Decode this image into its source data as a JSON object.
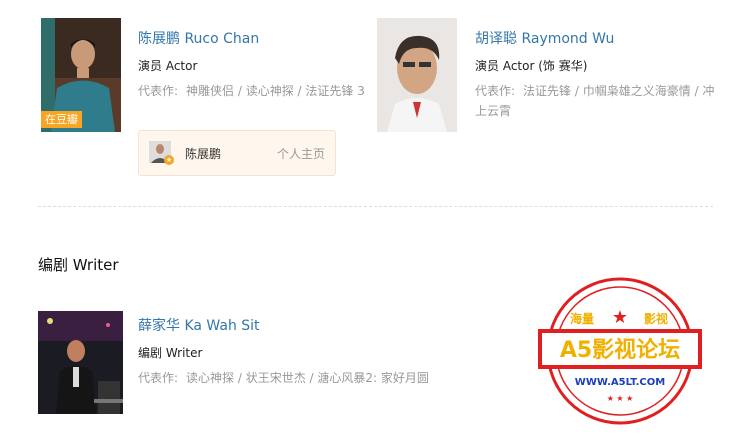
{
  "cast": [
    {
      "name": "陈展鹏 Ruco Chan",
      "role": "演员 Actor",
      "works_label": "代表作:",
      "works": "神雕侠侣 / 读心神探 / 法证先锋 3",
      "badge": "在豆瓣",
      "home": {
        "name": "陈展鹏",
        "link": "个人主页"
      }
    },
    {
      "name": "胡译聪 Raymond Wu",
      "role": "演员 Actor (饰 赛华)",
      "works_label": "代表作:",
      "works": "法证先锋 / 巾帼枭雄之义海豪情 / 冲上云霄"
    }
  ],
  "writer_section": {
    "title": "编剧 Writer",
    "person": {
      "name": "薛家华 Ka Wah Sit",
      "role": "编剧 Writer",
      "works_label": "代表作:",
      "works": "读心神探 / 状王宋世杰 / 溏心风暴2: 家好月圆"
    }
  },
  "watermark": {
    "top": "海量",
    "top_right": "影视",
    "main": "A5影视论坛",
    "url": "WWW.A5LT.COM"
  },
  "colors": {
    "link": "#3377aa",
    "badge": "#f6a623",
    "stamp": "#e02020"
  }
}
